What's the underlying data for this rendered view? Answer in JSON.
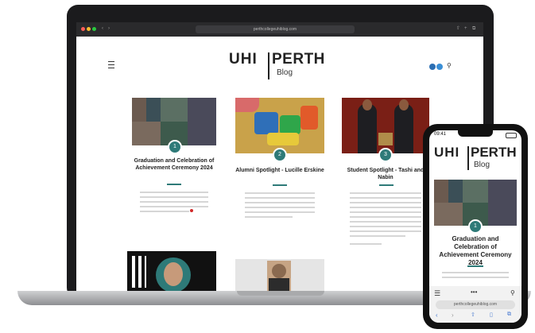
{
  "browser": {
    "url": "perthcollegeuhiblog.com"
  },
  "site": {
    "logo_left": "UHI",
    "logo_right": "PERTH",
    "subtitle": "Blog"
  },
  "posts": [
    {
      "number": "1",
      "title": "Graduation and Celebration of Achievement Ceremony 2024"
    },
    {
      "number": "2",
      "title": "Alumni Spotlight - Lucille Erskine"
    },
    {
      "number": "3",
      "title": "Student Spotlight - Tashi and Nabin"
    }
  ],
  "phone": {
    "status_time": "09:41",
    "logo_left": "UHI",
    "logo_right": "PERTH",
    "subtitle": "Blog",
    "post_number": "1",
    "post_title": "Graduation and Celebration of Achievement Ceremony 2024",
    "url": "perthcollegeuhiblog.com"
  },
  "colors": {
    "accent": "#2e7a78",
    "social_blue": "#2c6fb3"
  }
}
